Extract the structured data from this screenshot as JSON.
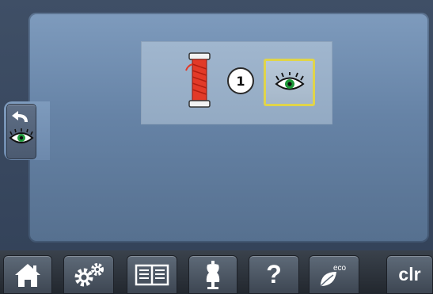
{
  "callout": {
    "number": "1"
  },
  "sidebar": {
    "back_icon": "back-arrow-icon",
    "view_icon": "eye-icon"
  },
  "content": {
    "thread_icon": "thread-spool-icon",
    "eye_toggle_icon": "eye-icon"
  },
  "nav": {
    "home_icon": "home-icon",
    "setup_icon": "gears-icon",
    "tutorial_icon": "book-icon",
    "consultant_icon": "dress-form-icon",
    "help_label": "?",
    "eco_label": "eco",
    "clr_label": "clr"
  },
  "colors": {
    "panel": "#6d89ac",
    "highlight_border": "#e0d44a",
    "spool_red": "#e23a28",
    "eye_iris": "#1e9a3a"
  }
}
